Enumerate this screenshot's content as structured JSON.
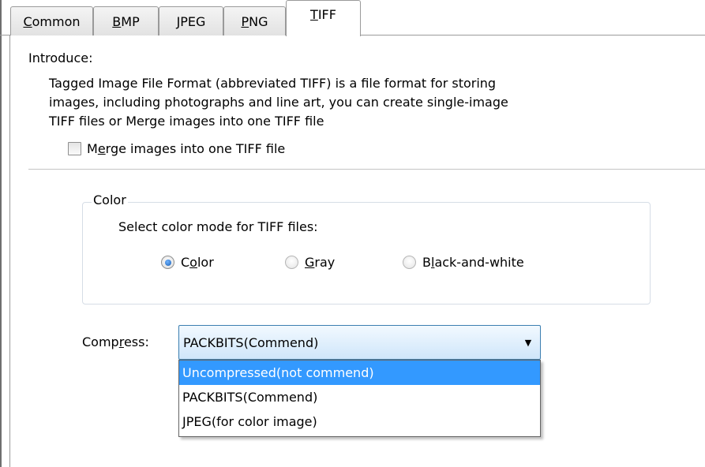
{
  "tabs": [
    {
      "label": "Common",
      "mnemonic_index": 0
    },
    {
      "label": "BMP",
      "mnemonic_index": 0
    },
    {
      "label": "JPEG",
      "mnemonic_index": 0
    },
    {
      "label": "PNG",
      "mnemonic_index": 0
    },
    {
      "label": "TIFF",
      "mnemonic_index": 0,
      "active": true
    }
  ],
  "intro": {
    "title": "Introduce:",
    "line1": "Tagged Image File Format (abbreviated TIFF) is a file format for storing",
    "line2": "images, including photographs and line art, you can create single-image",
    "line3": "TIFF files or Merge images into one TIFF file"
  },
  "merge_checkbox": {
    "label_pre": "M",
    "label_mn": "e",
    "label_post": "rge images into one TIFF file",
    "checked": false
  },
  "color_group": {
    "legend": "Color",
    "description": "Select color mode for TIFF files:",
    "options": [
      {
        "pre": "C",
        "mn": "o",
        "post": "lor",
        "selected": true
      },
      {
        "pre": "",
        "mn": "G",
        "post": "ray",
        "selected": false
      },
      {
        "pre": "B",
        "mn": "l",
        "post": "ack-and-white",
        "selected": false
      }
    ]
  },
  "compress": {
    "label_pre": "Comp",
    "label_mn": "r",
    "label_post": "ess:",
    "selected": "PACKBITS(Commend)",
    "options": [
      "Uncompressed(not commend)",
      "PACKBITS(Commend)",
      "JPEG(for color image)"
    ],
    "highlighted_index": 0
  },
  "colors": {
    "selection": "#3399ff",
    "combo_border": "#3c7fb1",
    "tab_border": "#9a9a9a"
  }
}
